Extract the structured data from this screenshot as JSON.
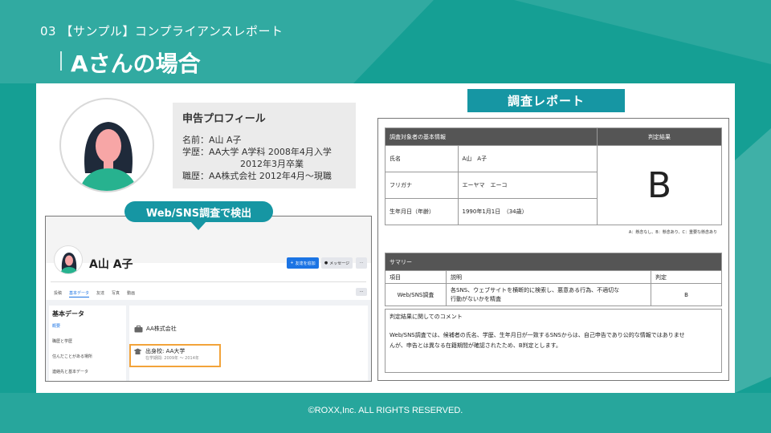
{
  "header": {
    "section_label": "03 【サンプル】コンプライアンスレポート",
    "title": "Aさんの場合"
  },
  "profile": {
    "heading": "申告プロフィール",
    "name_line": "名前：A山 A子",
    "education_line1": "学歴：AA大学 A学科 2008年4月入学",
    "education_line2": "2012年3月卒業",
    "career_line": "職歴：AA株式会社 2012年4月〜現職"
  },
  "callout": {
    "label": "Web/SNS調査で検出"
  },
  "sns": {
    "profile_name": "A山 A子",
    "add_friend_label": "友達を追加",
    "message_label": "メッセージ",
    "more_label": "···",
    "tabs": [
      "投稿",
      "基本データ",
      "友達",
      "写真",
      "動画"
    ],
    "tabs_more_label": "···",
    "about_title": "基本データ",
    "about_items": [
      "概要",
      "職歴と学歴",
      "住んだことがある場所",
      "連絡先と基本データ"
    ],
    "work": "AA株式会社",
    "school": "出身校: AA大学",
    "school_period": "在学期間: 2009年 〜 2014年"
  },
  "report": {
    "label": "調査レポート",
    "basic_info_header": "調査対象者の基本情報",
    "result_header": "判定結果",
    "rows": [
      {
        "label": "氏名",
        "value": "A山　A子"
      },
      {
        "label": "フリガナ",
        "value": "エーヤマ　エーコ"
      },
      {
        "label": "生年月日（年齢）",
        "value": "1990年1月1日　（34歳）"
      }
    ],
    "grade": "B",
    "legend": "A：懸念なし、B：懸念あり、C：重要な懸念あり",
    "summary_header": "サマリー",
    "summary_cols": [
      "項目",
      "説明",
      "判定"
    ],
    "summary_item": "Web/SNS調査",
    "summary_desc_line1": "各SNS、ウェブサイトを横断的に検索し、悪意ある行為、不適切な",
    "summary_desc_line2": "行動がないかを精査",
    "summary_grade": "B",
    "comment_title": "判定結果に関してのコメント",
    "comment_line1": "Web/SNS調査では、候補者の氏名、学歴、生年月日が一致するSNSからは、自己申告であり公的な情報ではありませ",
    "comment_line2": "んが、申告とは異なる在籍期間が確認されたため、B判定とします。"
  },
  "footer": {
    "copyright": "©ROXX,Inc. ALL RIGHTS RESERVED."
  },
  "colors": {
    "brand_teal": "#159f94",
    "label_teal": "#1696a3",
    "highlight": "#f2a33a",
    "sns_blue": "#1b74e4"
  }
}
